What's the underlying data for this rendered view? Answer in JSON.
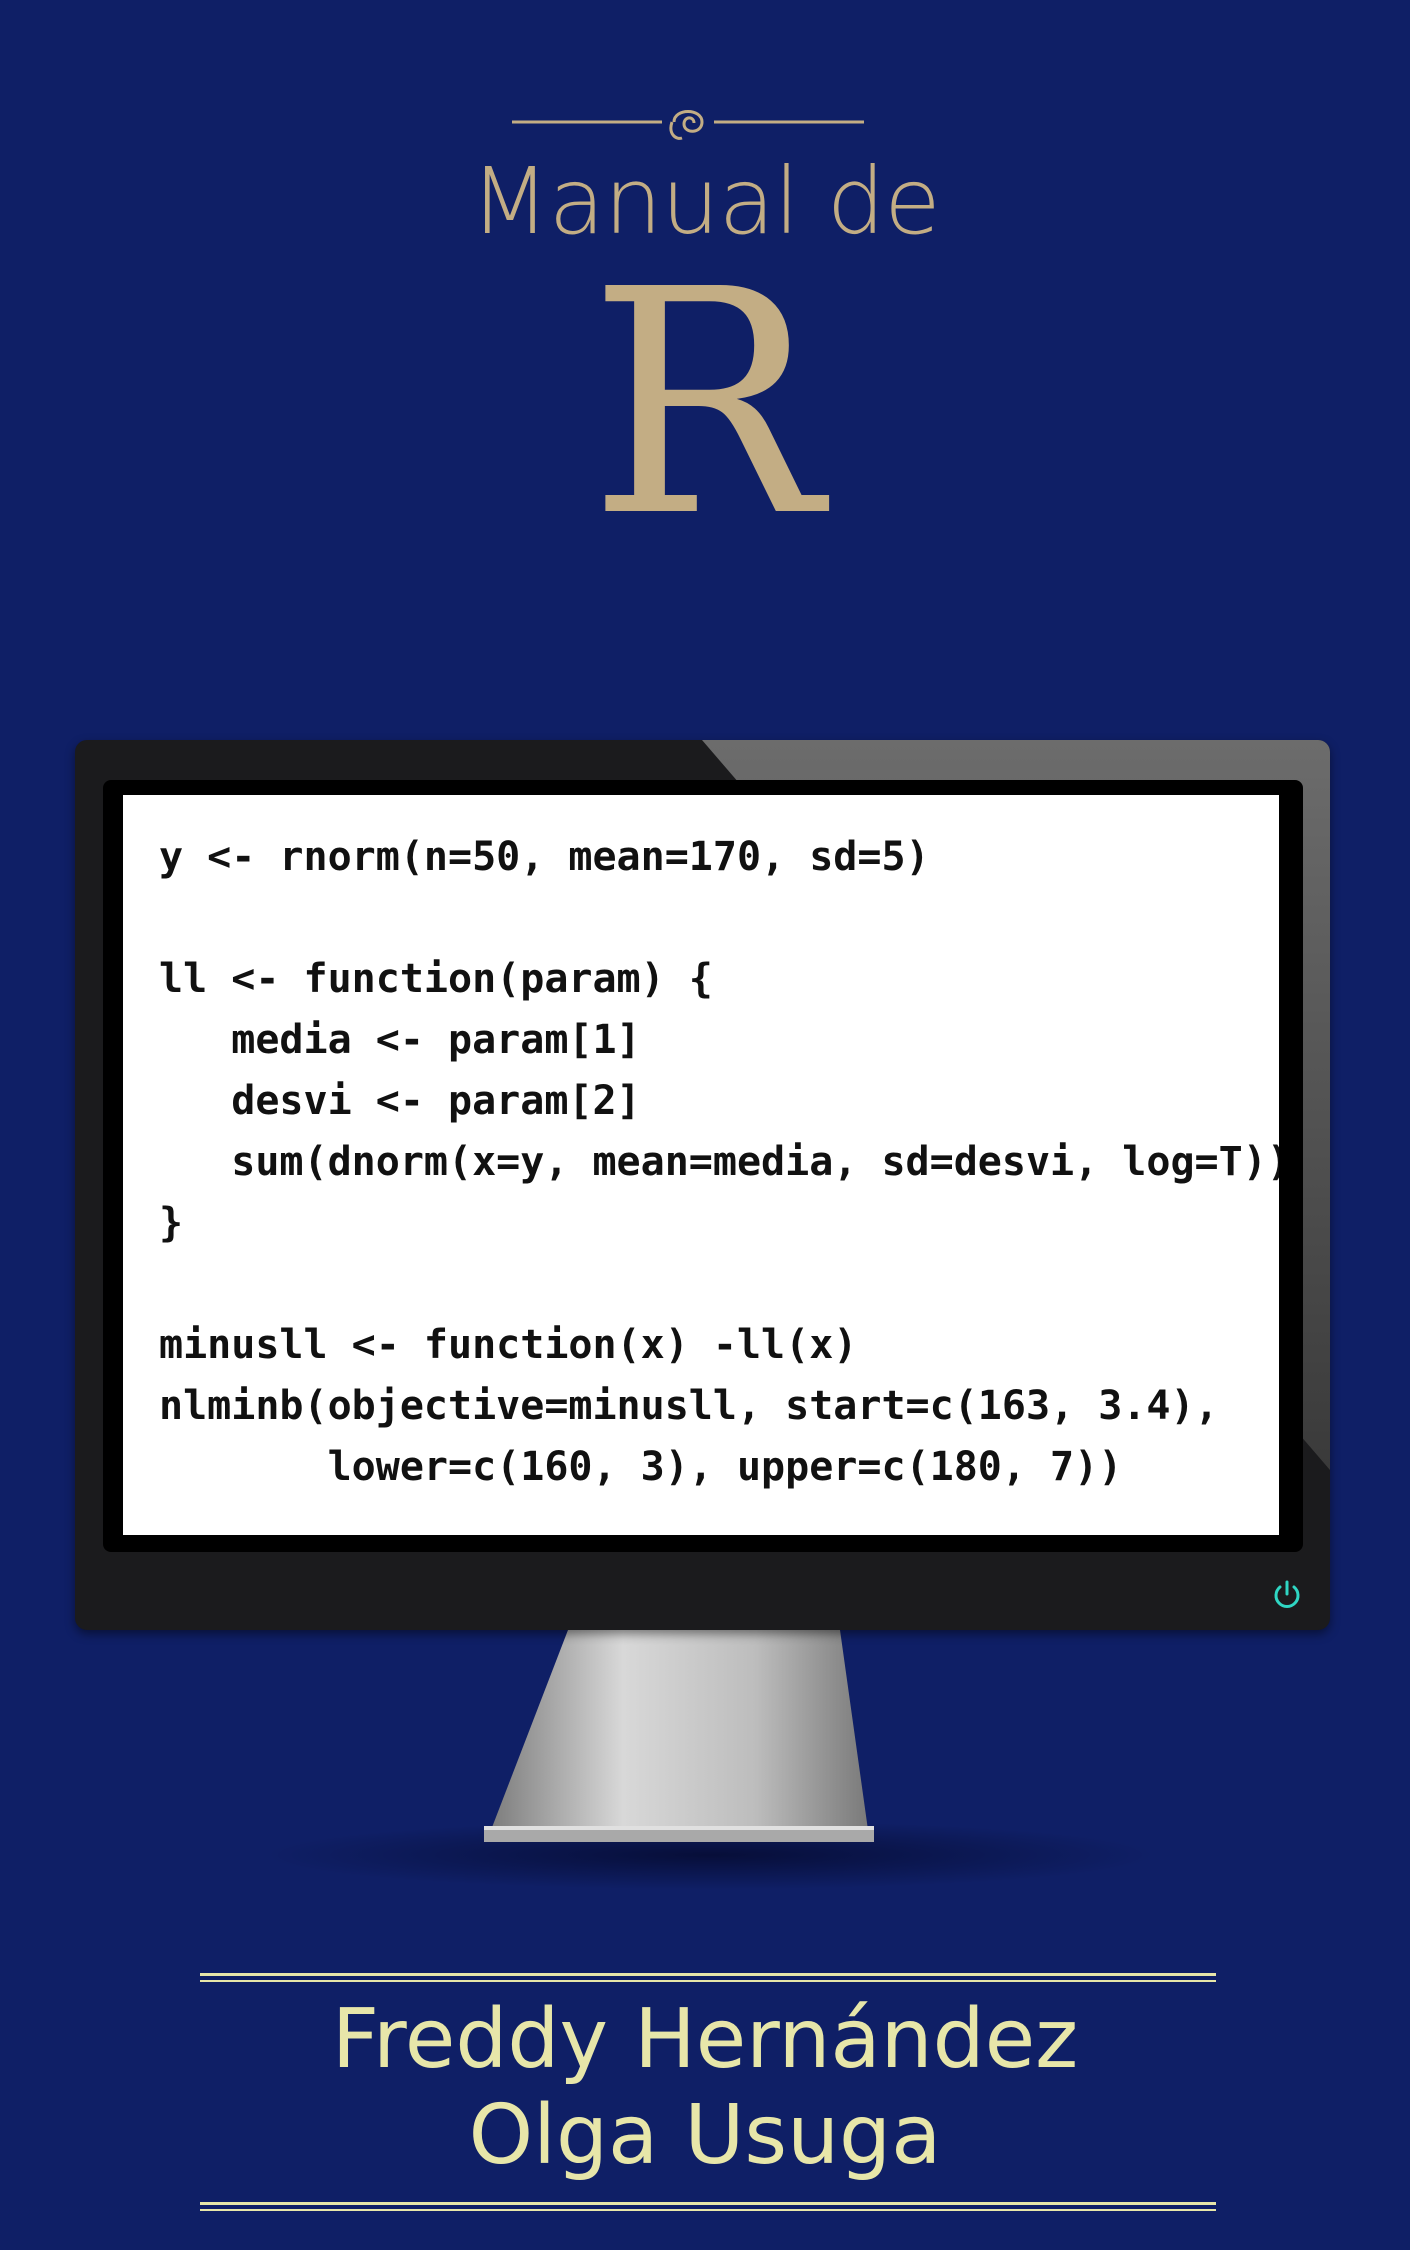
{
  "cover": {
    "subtitle": "Manual de",
    "title": "R",
    "authors": [
      "Freddy Hernández",
      "Olga Usuga"
    ]
  },
  "code_lines": [
    "y <- rnorm(n=50, mean=170, sd=5)",
    "",
    "ll <- function(param) {",
    "   media <- param[1]",
    "   desvi <- param[2]",
    "   sum(dnorm(x=y, mean=media, sd=desvi, log=T))",
    "}",
    "",
    "minusll <- function(x) -ll(x)",
    "nlminb(objective=minusll, start=c(163, 3.4),",
    "       lower=c(160, 3), upper=c(180, 7))"
  ],
  "icons": {
    "ornament": "scroll-ornament-icon",
    "power": "power-icon"
  },
  "colors": {
    "background": "#0f1f66",
    "gold": "#c3ad84",
    "author_yellow": "#e7e6a9",
    "power_teal": "#2fd6c3"
  }
}
